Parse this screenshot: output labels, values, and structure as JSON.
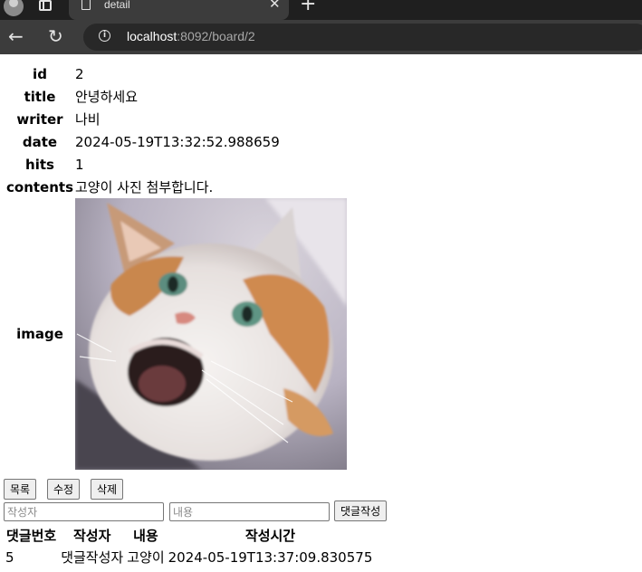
{
  "browser": {
    "tab_title": "detail",
    "url_host": "localhost",
    "url_rest": ":8092/board/2"
  },
  "board": {
    "labels": {
      "id": "id",
      "title": "title",
      "writer": "writer",
      "date": "date",
      "hits": "hits",
      "contents": "contents",
      "image": "image"
    },
    "id": "2",
    "title": "안녕하세요",
    "writer": "나비",
    "date": "2024-05-19T13:32:52.988659",
    "hits": "1",
    "contents": "고양이 사진 첨부합니다."
  },
  "buttons": {
    "list": "목록",
    "edit": "수정",
    "delete": "삭제",
    "comment_submit": "댓글작성"
  },
  "comment_form": {
    "writer_placeholder": "작성자",
    "content_placeholder": "내용"
  },
  "comments": {
    "headers": [
      "댓글번호",
      "작성자",
      "내용",
      "작성시간"
    ],
    "rows": [
      [
        "5",
        "댓글작성자",
        "고양이",
        "2024-05-19T13:37:09.830575"
      ]
    ]
  },
  "colors": {
    "tabbar": "#1f1f1f",
    "toolbar": "#3c3c3c",
    "omnibox": "#282828"
  }
}
